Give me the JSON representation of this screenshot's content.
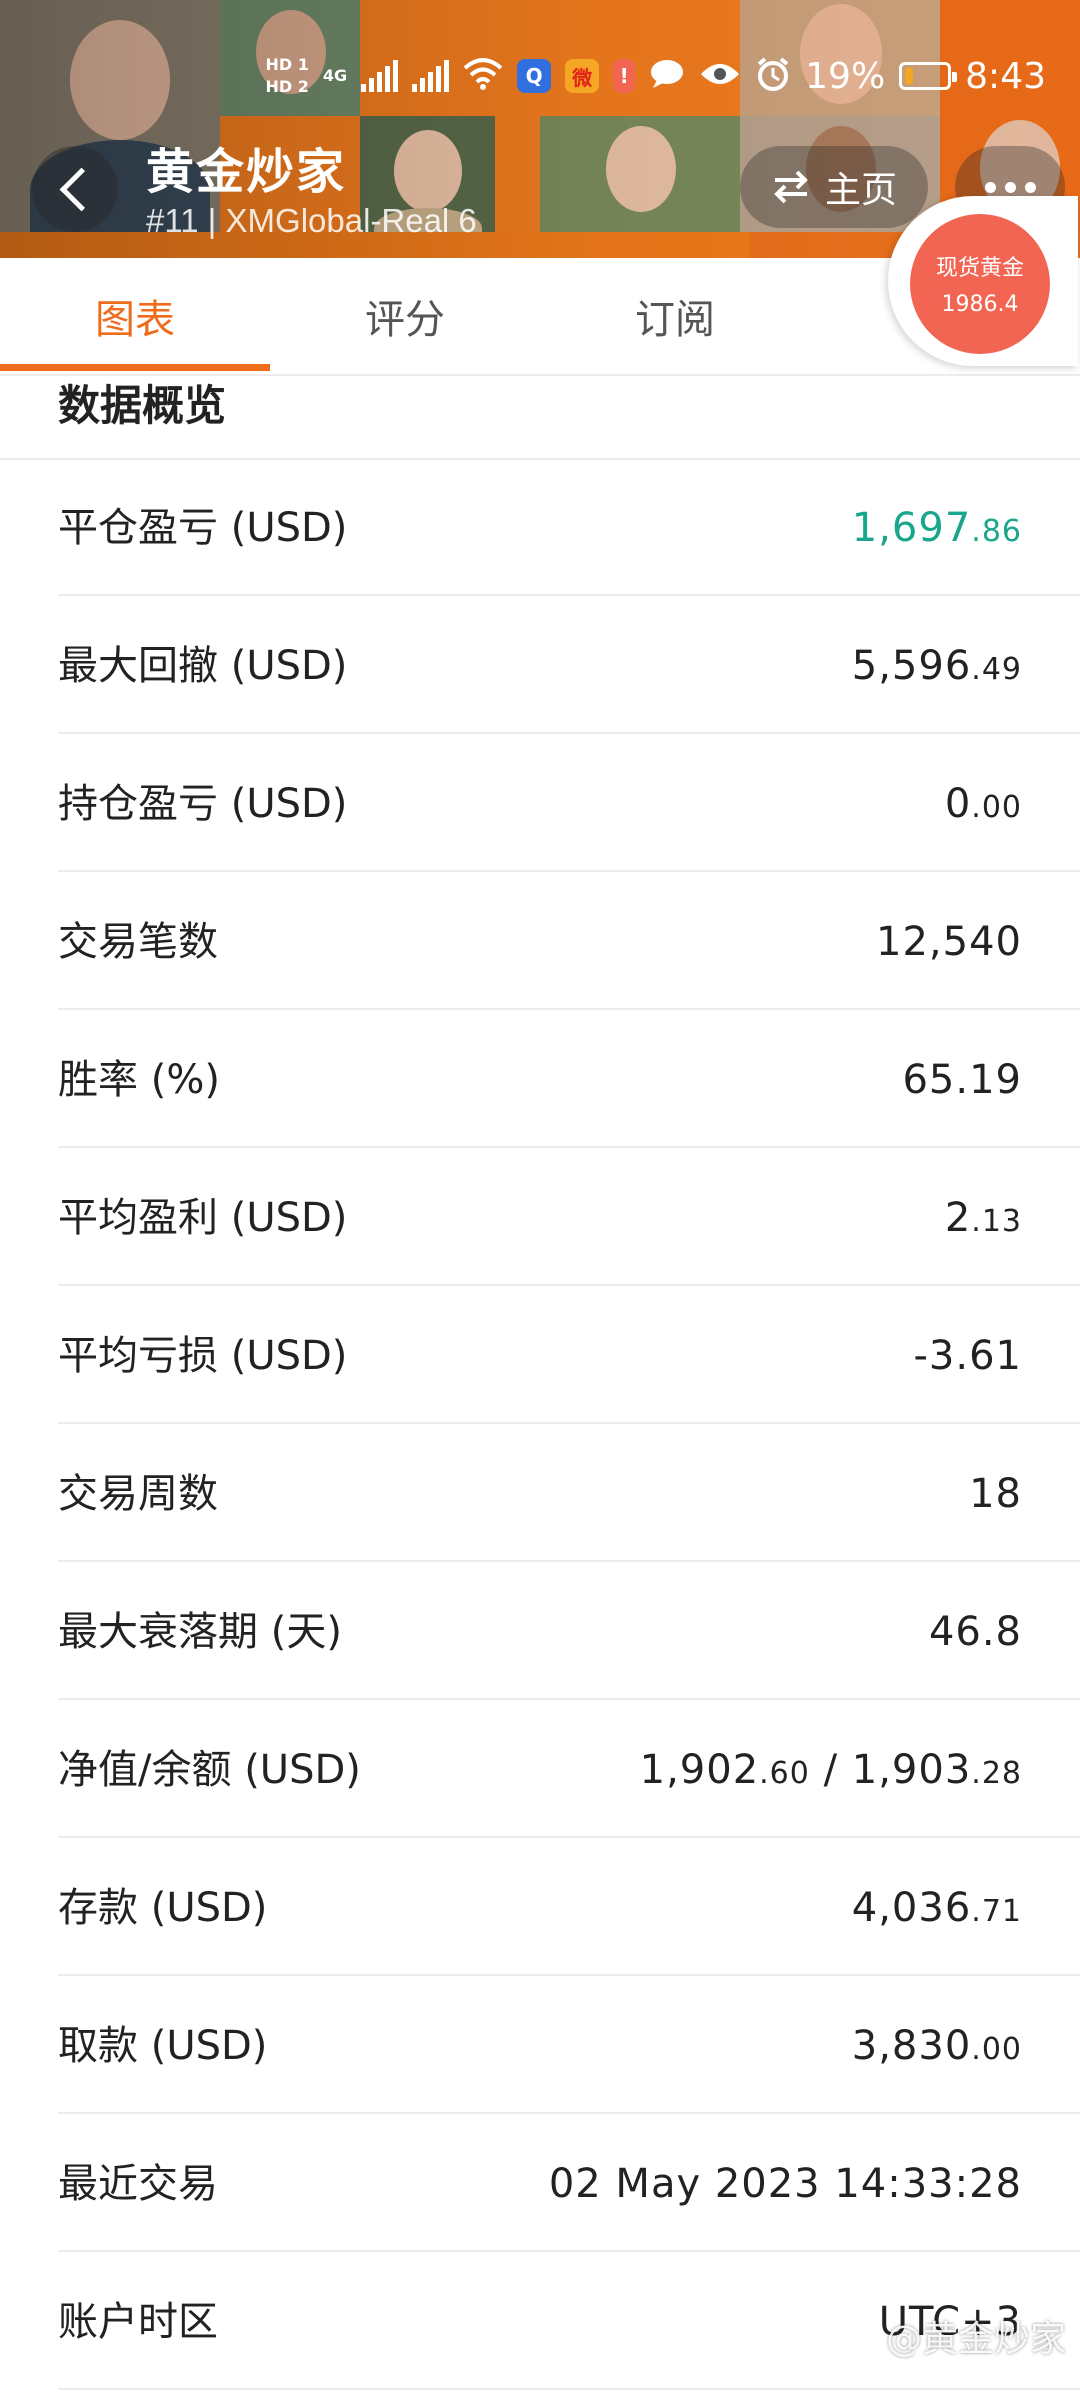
{
  "status_bar": {
    "sim1": "HD 1",
    "sim2": "HD 2",
    "network": "4G",
    "battery_percent": "19%",
    "battery_level": 0.19,
    "time": "8:43"
  },
  "header": {
    "title": "黄金炒家",
    "subtitle": "#11 | XMGlobal-Real 6",
    "home_label": "主页"
  },
  "price_badge": {
    "name": "现货黄金",
    "price": "1986.4"
  },
  "tabs": [
    {
      "label": "图表",
      "active": true
    },
    {
      "label": "评分",
      "active": false
    },
    {
      "label": "订阅",
      "active": false
    }
  ],
  "section": {
    "title": "数据概览"
  },
  "rows": [
    {
      "label": "平仓盈亏 (USD)",
      "int": "1,697",
      "dec": ".86",
      "color": "#1aa68c"
    },
    {
      "label": "最大回撤 (USD)",
      "int": "5,596",
      "dec": ".49"
    },
    {
      "label": "持仓盈亏 (USD)",
      "int": "0",
      "dec": ".00"
    },
    {
      "label": "交易笔数",
      "int": "12,540",
      "dec": ""
    },
    {
      "label": "胜率 (%)",
      "int": "65.19",
      "dec": ""
    },
    {
      "label": "平均盈利 (USD)",
      "int": "2",
      "dec": ".13"
    },
    {
      "label": "平均亏损 (USD)",
      "int": "-3.61",
      "dec": ""
    },
    {
      "label": "交易周数",
      "int": "18",
      "dec": ""
    },
    {
      "label": "最大衰落期 (天)",
      "int": "46.8",
      "dec": ""
    },
    {
      "label": "净值/余额 (USD)",
      "int": "1,902",
      "dec": ".60",
      "sep": " / ",
      "int2": "1,903",
      "dec2": ".28"
    },
    {
      "label": "存款 (USD)",
      "int": "4,036",
      "dec": ".71"
    },
    {
      "label": "取款 (USD)",
      "int": "3,830",
      "dec": ".00"
    },
    {
      "label": "最近交易",
      "int": "02 May 2023 14:33:28",
      "dec": ""
    },
    {
      "label": "账户时区",
      "int": "UTC+3",
      "dec": ""
    }
  ],
  "watermark": "@黄金炒家",
  "colors": {
    "accent": "#ef6c1c",
    "profit_green": "#1aa68c",
    "badge_red": "#f26552"
  }
}
